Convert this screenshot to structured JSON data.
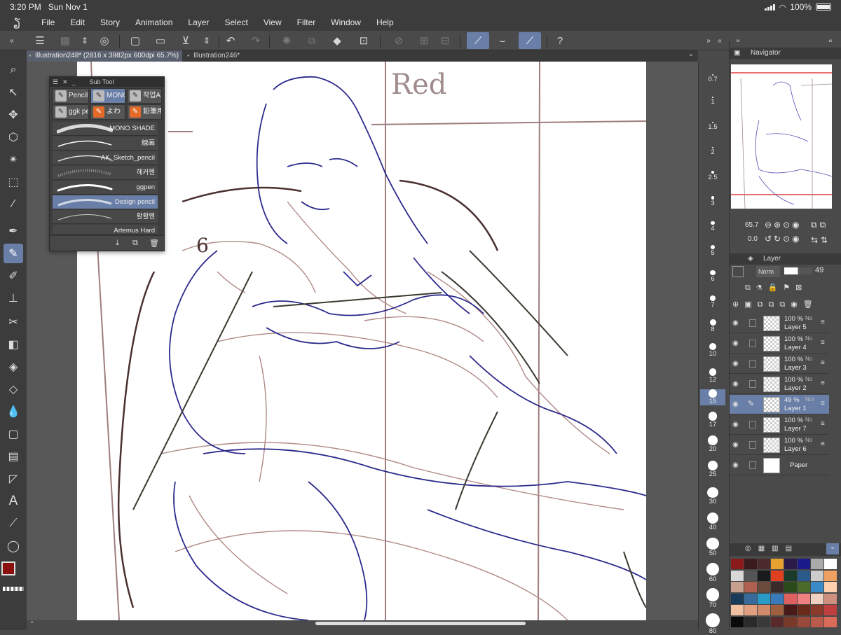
{
  "status_bar": {
    "time": "3:20 PM",
    "date": "Sun Nov 1",
    "battery": "100%"
  },
  "menu": [
    "File",
    "Edit",
    "Story",
    "Animation",
    "Layer",
    "Select",
    "View",
    "Filter",
    "Window",
    "Help"
  ],
  "tabs": [
    {
      "label": "Illustration248* (2816 x 3982px 600dpi 65.7%)",
      "active": true
    },
    {
      "label": "Illustration246*",
      "active": false
    }
  ],
  "sub_tool": {
    "title": "Sub Tool",
    "groups": [
      {
        "label": "Pencil",
        "icon": "pencil-icon"
      },
      {
        "label": "MONO",
        "icon": "pencil-icon",
        "selected": true
      },
      {
        "label": "작업A",
        "icon": "pencil-icon"
      },
      {
        "label": "ggk pe",
        "icon": "pencil-icon"
      },
      {
        "label": "よわ",
        "icon": "orange-pen-icon"
      },
      {
        "label": "鉛筆用",
        "icon": "orange-pen-icon"
      }
    ],
    "brushes": [
      {
        "name": "MONO SHADE"
      },
      {
        "name": "線画"
      },
      {
        "name": "AK_Sketch_pencil"
      },
      {
        "name": "헤커펜"
      },
      {
        "name": "ggpen"
      },
      {
        "name": "Design pencil",
        "selected": true
      },
      {
        "name": "활활펜"
      },
      {
        "name": "Artemus Hard"
      }
    ]
  },
  "canvas_text": {
    "annotation": "Red",
    "number": "6"
  },
  "brush_sizes": [
    "0.7",
    "1",
    "1.5",
    "2",
    "2.5",
    "3",
    "4",
    "5",
    "6",
    "7",
    "8",
    "10",
    "12",
    "15",
    "17",
    "20",
    "25",
    "30",
    "40",
    "50",
    "60",
    "70",
    "80"
  ],
  "selected_brush_size": "15",
  "navigator": {
    "title": "Navigator",
    "zoom": "65.7",
    "rotation": "0.0"
  },
  "layer_panel": {
    "title": "Layer",
    "blend_mode": "Norm",
    "opacity": "49",
    "layers": [
      {
        "opacity": "100 %",
        "mode": "No",
        "name": "Layer 5"
      },
      {
        "opacity": "100 %",
        "mode": "No",
        "name": "Layer 4"
      },
      {
        "opacity": "100 %",
        "mode": "No",
        "name": "Layer 3"
      },
      {
        "opacity": "100 %",
        "mode": "No",
        "name": "Layer 2"
      },
      {
        "opacity": "49 %",
        "mode": "Nor",
        "name": "Layer 1",
        "selected": true
      },
      {
        "opacity": "100 %",
        "mode": "No",
        "name": "Layer 7"
      },
      {
        "opacity": "100 %",
        "mode": "No",
        "name": "Layer 6"
      },
      {
        "opacity": "",
        "mode": "",
        "name": "Paper"
      }
    ]
  },
  "colors": {
    "main": "#8b1010",
    "sub": "#222222",
    "accent": "#6a7fa8",
    "palette": [
      "#8b1a1a",
      "#3a1a1a",
      "#4a2a2a",
      "#e8a030",
      "#2a1a4a",
      "#1a1a8a",
      "#aaaaaa",
      "#ffffff",
      "#d8d8d8",
      "#555555",
      "#1a1a1a",
      "#e04020",
      "#1a3a2a",
      "#2a5a8a",
      "#cccccc",
      "#f0a060",
      "#c8a090",
      "#b06050",
      "#6a4a3a",
      "#3a2a2a",
      "#2a4a1a",
      "#4a6a2a",
      "#3a8ac8",
      "#ffd0b0",
      "#1a3a5a",
      "#3a6a9a",
      "#2a9ac8",
      "#3a7ab8",
      "#e06060",
      "#f08080",
      "#f0d0c0",
      "#d09080",
      "#f0c0a0",
      "#e0a080",
      "#d08a6a",
      "#a06040",
      "#4a1a1a",
      "#6a2a1a",
      "#8a3a2a",
      "#c04040",
      "#0a0a0a",
      "#2a2a2a",
      "#3a3a3a",
      "#5a2a2a",
      "#7a3a2a",
      "#9a4a3a",
      "#ba5a4a",
      "#da6a5a"
    ]
  }
}
